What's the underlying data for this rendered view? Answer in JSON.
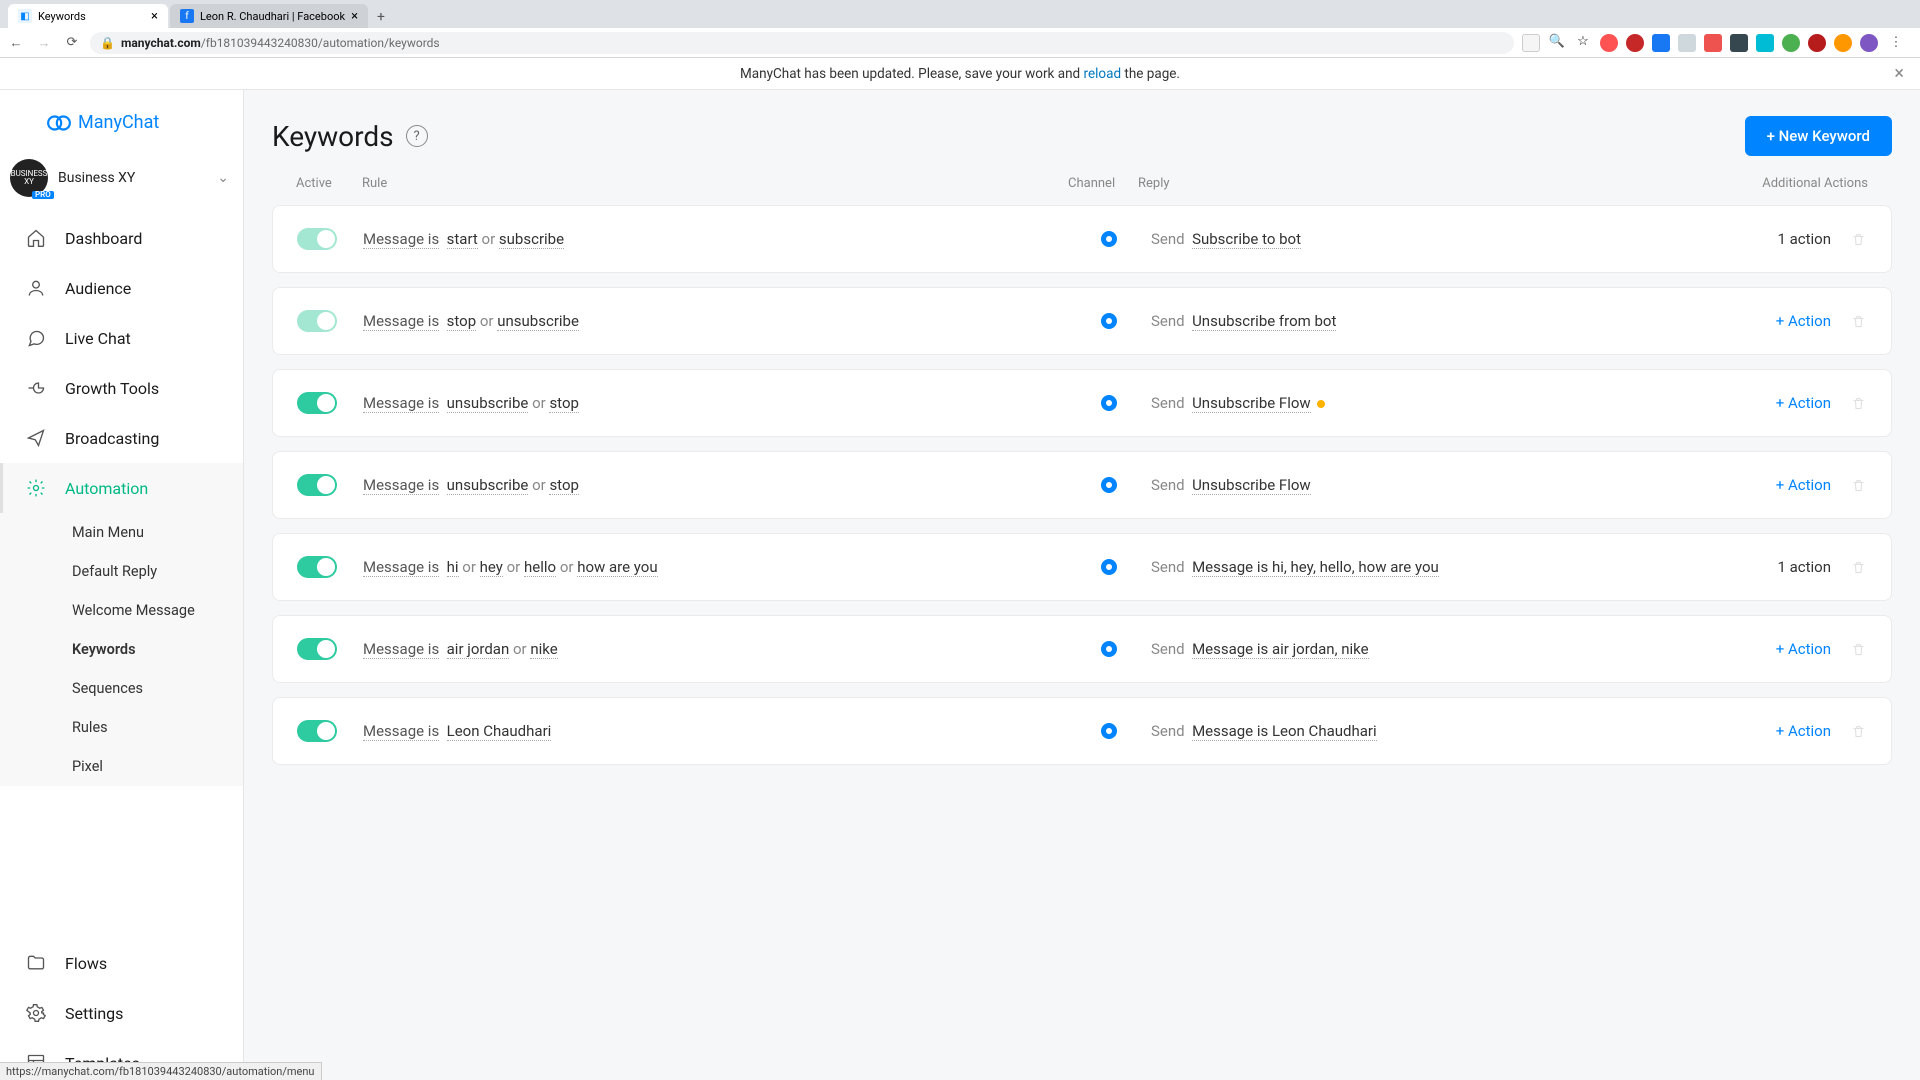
{
  "browser": {
    "tabs": [
      {
        "title": "Keywords",
        "favicon_color": "#0084ff"
      },
      {
        "title": "Leon R. Chaudhari | Facebook",
        "favicon_color": "#1877f2"
      }
    ],
    "url_prefix": "manychat.com",
    "url_path": "/fb181039443240830/automation/keywords"
  },
  "banner": {
    "prefix": "ManyChat has been updated. Please, save your work and ",
    "link": "reload",
    "suffix": " the page."
  },
  "logo_text": "ManyChat",
  "account": {
    "name": "Business XY",
    "badge": "PRO",
    "avatar_text": "BUSINESS XY"
  },
  "nav": {
    "items": [
      {
        "label": "Dashboard"
      },
      {
        "label": "Audience"
      },
      {
        "label": "Live Chat"
      },
      {
        "label": "Growth Tools"
      },
      {
        "label": "Broadcasting"
      },
      {
        "label": "Automation"
      }
    ],
    "sub_items": [
      "Main Menu",
      "Default Reply",
      "Welcome Message",
      "Keywords",
      "Sequences",
      "Rules",
      "Pixel"
    ],
    "bottom": [
      "Flows",
      "Settings",
      "Templates"
    ]
  },
  "page": {
    "title": "Keywords",
    "new_btn": "+ New Keyword",
    "cols": {
      "active": "Active",
      "rule": "Rule",
      "channel": "Channel",
      "reply": "Reply",
      "actions": "Additional Actions"
    }
  },
  "rule_labels": {
    "prefix": "Message is",
    "or": "or",
    "send": "Send"
  },
  "rows": [
    {
      "active": true,
      "pale": true,
      "keywords": [
        "start",
        "subscribe"
      ],
      "reply": "Subscribe to bot",
      "action": "1 action",
      "action_link": false,
      "status_dot": false
    },
    {
      "active": true,
      "pale": true,
      "keywords": [
        "stop",
        "unsubscribe"
      ],
      "reply": "Unsubscribe from bot",
      "action": "+ Action",
      "action_link": true,
      "status_dot": false
    },
    {
      "active": true,
      "pale": false,
      "keywords": [
        "unsubscribe",
        "stop"
      ],
      "reply": "Unsubscribe Flow",
      "action": "+ Action",
      "action_link": true,
      "status_dot": true
    },
    {
      "active": true,
      "pale": false,
      "keywords": [
        "unsubscribe",
        "stop"
      ],
      "reply": "Unsubscribe Flow",
      "action": "+ Action",
      "action_link": true,
      "status_dot": false
    },
    {
      "active": true,
      "pale": false,
      "keywords": [
        "hi",
        "hey",
        "hello",
        "how are you"
      ],
      "reply": "Message is hi, hey, hello, how are you",
      "action": "1 action",
      "action_link": false,
      "status_dot": false
    },
    {
      "active": true,
      "pale": false,
      "keywords": [
        "air jordan",
        "nike"
      ],
      "reply": "Message is air jordan, nike",
      "action": "+ Action",
      "action_link": true,
      "status_dot": false
    },
    {
      "active": true,
      "pale": false,
      "keywords": [
        "Leon Chaudhari"
      ],
      "reply": "Message is Leon Chaudhari",
      "action": "+ Action",
      "action_link": true,
      "status_dot": false
    }
  ],
  "status_url": "https://manychat.com/fb181039443240830/automation/menu"
}
